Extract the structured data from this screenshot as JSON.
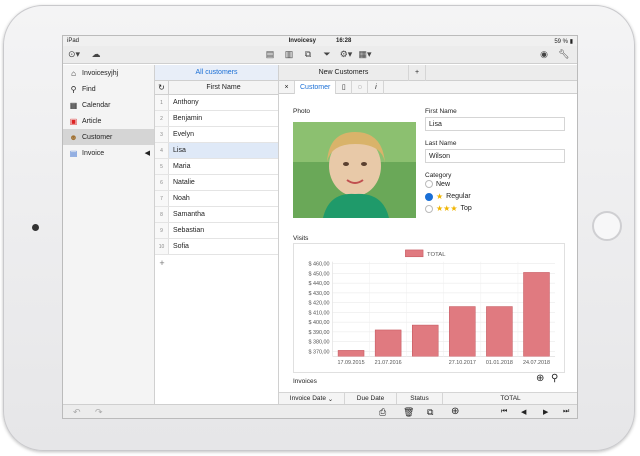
{
  "status": {
    "device": "iPad",
    "title": "Invoicesy",
    "time": "16:28",
    "battery": "59 %"
  },
  "sidebar": {
    "items": [
      {
        "label": "Invoicesyjhj",
        "icon": "home-icon"
      },
      {
        "label": "Find",
        "icon": "search-icon"
      },
      {
        "label": "Calendar",
        "icon": "calendar-icon"
      },
      {
        "label": "Article",
        "icon": "gift-icon"
      },
      {
        "label": "Customer",
        "icon": "customer-icon",
        "active": true
      },
      {
        "label": "Invoice",
        "icon": "invoice-icon"
      }
    ]
  },
  "list": {
    "tab_label": "All customers",
    "column_header": "First Name",
    "rows": [
      {
        "num": "1",
        "name": "Anthony"
      },
      {
        "num": "2",
        "name": "Benjamin"
      },
      {
        "num": "3",
        "name": "Evelyn"
      },
      {
        "num": "4",
        "name": "Lisa"
      },
      {
        "num": "5",
        "name": "Maria"
      },
      {
        "num": "6",
        "name": "Natalie"
      },
      {
        "num": "7",
        "name": "Noah"
      },
      {
        "num": "8",
        "name": "Samantha"
      },
      {
        "num": "9",
        "name": "Sebastian"
      },
      {
        "num": "10",
        "name": "Sofia"
      }
    ],
    "add_label": "+"
  },
  "detail": {
    "tab_new": "New Customers",
    "tab_add": "+",
    "subtab_close": "×",
    "subtab_customer": "Customer",
    "subtab_info": "i",
    "photo_label": "Photo",
    "first_name_label": "First Name",
    "first_name_value": "Lisa",
    "last_name_label": "Last Name",
    "last_name_value": "Wilson",
    "category_label": "Category",
    "categories": [
      {
        "label": "New",
        "selected": false,
        "stars": 0
      },
      {
        "label": "Regular",
        "selected": true,
        "stars": 1
      },
      {
        "label": "Top",
        "selected": false,
        "stars": 3
      }
    ],
    "visits_label": "Visits",
    "invoices_label": "Invoices",
    "invoice_columns": [
      "Invoice Date",
      "Due Date",
      "Status",
      "TOTAL"
    ]
  },
  "chart_data": {
    "type": "bar",
    "legend": [
      "TOTAL"
    ],
    "series_color": "#e07a80",
    "categories": [
      "17.09.2015",
      "21.07.2016",
      "",
      "27.10.2017",
      "01.01.2018",
      "24.07.2018"
    ],
    "values": [
      371,
      392,
      397,
      416,
      416,
      451
    ],
    "ylim": [
      365,
      462
    ],
    "yticks": [
      "$ 370,00",
      "$ 380,00",
      "$ 390,00",
      "$ 400,00",
      "$ 410,00",
      "$ 420,00",
      "$ 430,00",
      "$ 440,00",
      "$ 450,00",
      "$ 460,00"
    ],
    "ytick_values": [
      370,
      380,
      390,
      400,
      410,
      420,
      430,
      440,
      450,
      460
    ],
    "grid": true,
    "legend_position": "top"
  }
}
